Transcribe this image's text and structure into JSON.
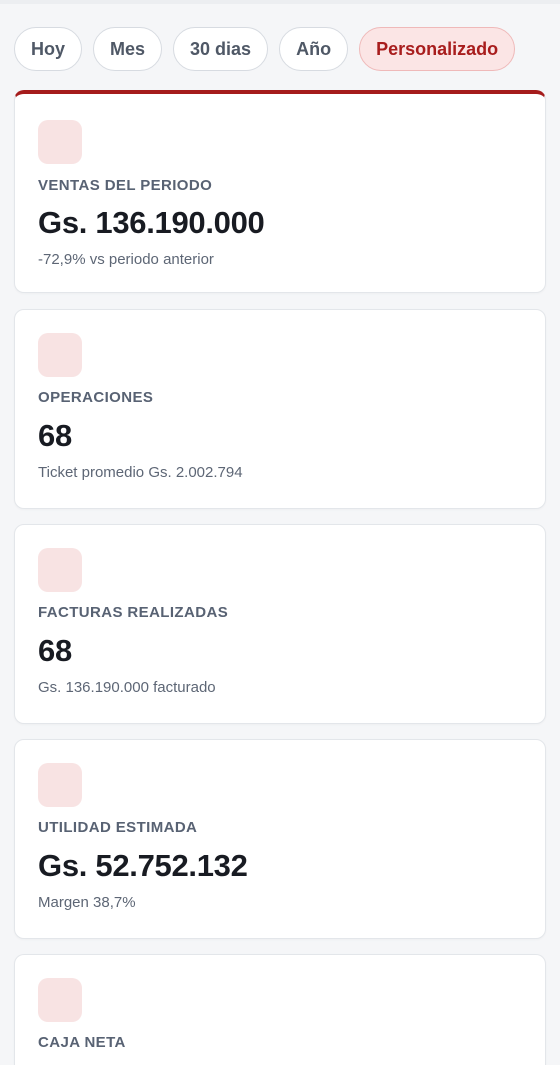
{
  "filters": [
    {
      "label": "Hoy",
      "active": false
    },
    {
      "label": "Mes",
      "active": false
    },
    {
      "label": "30 dias",
      "active": false
    },
    {
      "label": "Año",
      "active": false
    },
    {
      "label": "Personalizado",
      "active": true
    }
  ],
  "cards": [
    {
      "label": "VENTAS DEL PERIODO",
      "value": "Gs. 136.190.000",
      "subtitle": "-72,9% vs periodo anterior"
    },
    {
      "label": "OPERACIONES",
      "value": "68",
      "subtitle": "Ticket promedio Gs. 2.002.794"
    },
    {
      "label": "FACTURAS REALIZADAS",
      "value": "68",
      "subtitle": "Gs. 136.190.000 facturado"
    },
    {
      "label": "UTILIDAD ESTIMADA",
      "value": "Gs. 52.752.132",
      "subtitle": "Margen 38,7%"
    },
    {
      "label": "CAJA NETA"
    }
  ],
  "colors": {
    "accent": "#a51c1c",
    "active_chip_bg": "#fbe5e5",
    "icon_bg": "#f8e3e3"
  }
}
